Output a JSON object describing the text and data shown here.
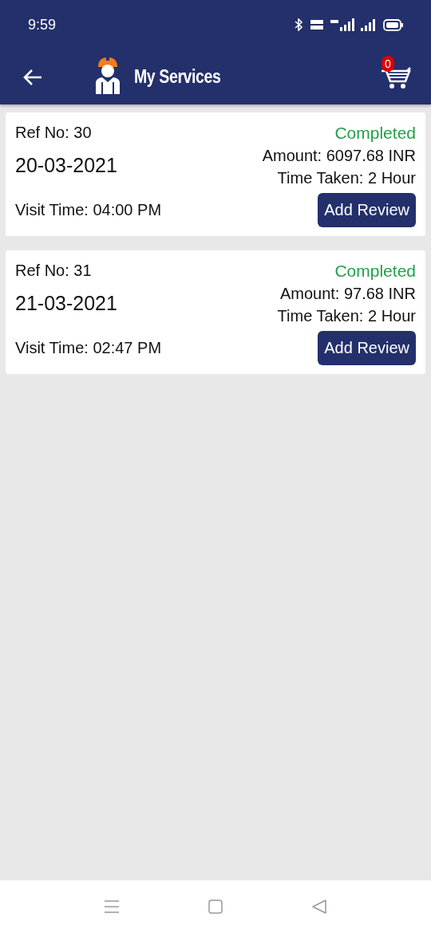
{
  "status_bar": {
    "time": "9:59"
  },
  "header": {
    "title": "My Services",
    "cart_count": "0"
  },
  "services": [
    {
      "ref": "Ref No: 30",
      "date": "20-03-2021",
      "visit_time": "Visit Time: 04:00 PM",
      "status": {
        "label": "Completed",
        "kind": "completed"
      },
      "amount": "Amount: 6097.68 INR",
      "time_taken": "Time Taken: 2 Hour",
      "action": "Add Review"
    },
    {
      "ref": "Ref No: 31",
      "date": "21-03-2021",
      "visit_time": "Visit Time: 02:47 PM",
      "status": {
        "label": "Completed",
        "kind": "completed"
      },
      "amount": "Amount: 97.68 INR",
      "time_taken": "Time Taken: 2 Hour",
      "action": "Add Review"
    }
  ]
}
